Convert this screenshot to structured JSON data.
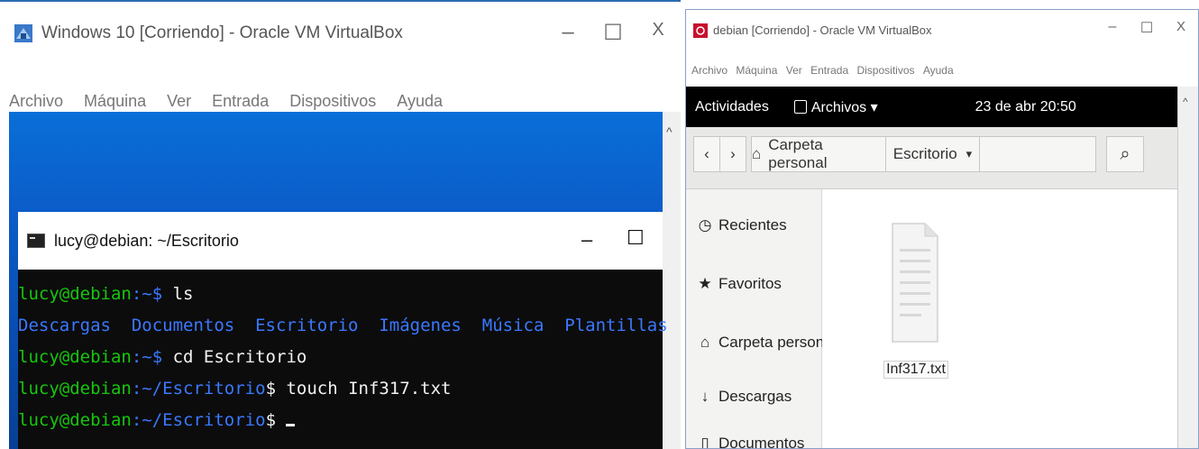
{
  "left_vm": {
    "title": "Windows 10 [Corriendo] - Oracle VM VirtualBox",
    "menu": [
      "Archivo",
      "Máquina",
      "Ver",
      "Entrada",
      "Dispositivos",
      "Ayuda"
    ],
    "controls": {
      "minimize": "–",
      "maximize": "☐",
      "close": "X"
    },
    "scroll_up": "^",
    "terminal": {
      "title": "lucy@debian: ~/Escritorio",
      "controls": {
        "minimize": "–",
        "maximize": "☐"
      },
      "prompt_user": "lucy@debian",
      "prompt_home": ":~$",
      "prompt_dir": ":~/Escritorio",
      "prompt_dollar": "$",
      "cmd1": " ls",
      "ls_output": "Descargas  Documentos  Escritorio  Imágenes  Música  Plantillas  Público  Vídeos",
      "cmd2": " cd Escritorio",
      "cmd3": " touch Inf317.txt"
    }
  },
  "right_vm": {
    "title": "debian [Corriendo] - Oracle VM VirtualBox",
    "menu": [
      "Archivo",
      "Máquina",
      "Ver",
      "Entrada",
      "Dispositivos",
      "Ayuda"
    ],
    "controls": {
      "minimize": "–",
      "maximize": "☐",
      "close": "X"
    },
    "gnome": {
      "activities": "Actividades",
      "app_menu": "Archivos ▾",
      "clock": "23 de abr  20:50"
    },
    "nautilus": {
      "back": "‹",
      "forward": "›",
      "home_label": "Carpeta personal",
      "current": "Escritorio",
      "current_arrow": "▾",
      "search": "⌕",
      "sidebar": [
        {
          "icon": "clock-icon",
          "glyph": "◷",
          "label": "Recientes"
        },
        {
          "icon": "star-icon",
          "glyph": "★",
          "label": "Favoritos"
        },
        {
          "icon": "home-icon",
          "glyph": "⌂",
          "label": "Carpeta personal"
        },
        {
          "icon": "download-icon",
          "glyph": "↓",
          "label": "Descargas"
        },
        {
          "icon": "documents-icon",
          "glyph": "▯",
          "label": "Documentos"
        }
      ],
      "file": {
        "name": "Inf317.txt",
        "icon": "text-file-icon"
      }
    },
    "scroll_up": "^"
  }
}
